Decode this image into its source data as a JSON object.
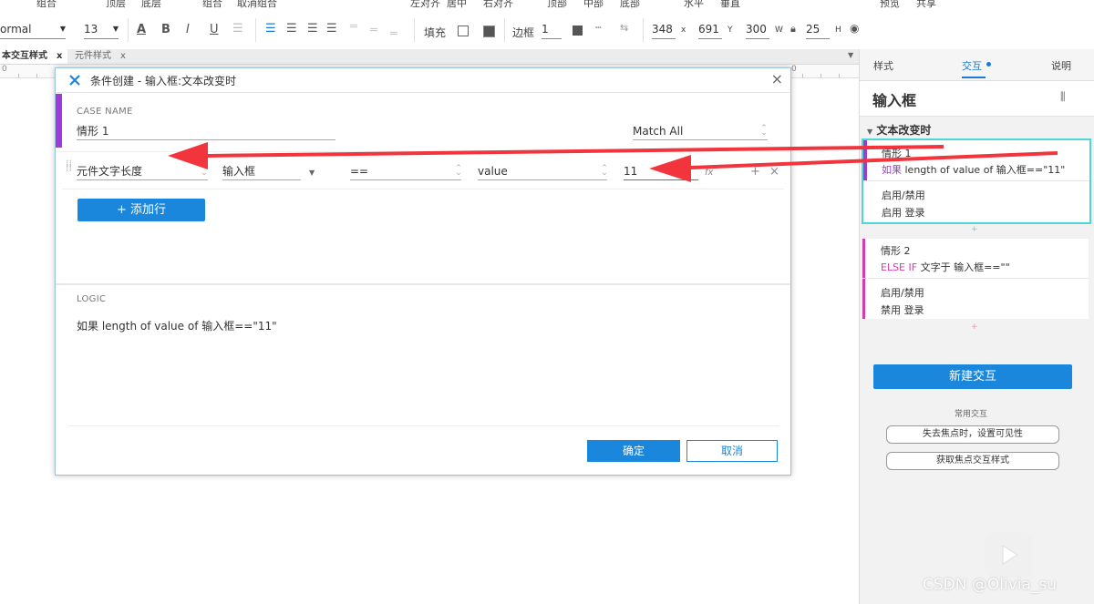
{
  "top_cut": [
    "组合",
    "顶层",
    "底层",
    "组合",
    "取消组合",
    "左对齐",
    "居中",
    "右对齐",
    "顶部",
    "中部",
    "底部",
    "水平",
    "垂直",
    "预览",
    "共享"
  ],
  "toolbar": {
    "style_value": "ormal",
    "font_size": "13",
    "fill_label": "填充",
    "border_label": "边框",
    "border_value": "1",
    "x_value": "348",
    "x_label": "x",
    "y_value": "691",
    "y_label": "Y",
    "w_value": "300",
    "w_label": "W",
    "h_value": "25",
    "h_label": "H"
  },
  "doc_tabs": [
    {
      "label": "本交互样式",
      "close": "x"
    },
    {
      "label": "元件样式",
      "close": "x"
    }
  ],
  "ruler": {
    "left_mark": "0",
    "right_mark": "0"
  },
  "right_panel": {
    "tabs": [
      "样式",
      "交互",
      "说明"
    ],
    "widget_name": "输入框",
    "event_name": "文本改变时",
    "case1": {
      "name": "情形 1",
      "cond_keyword": "如果",
      "cond_text": "length of value of 输入框==\"11\"",
      "action_title": "启用/禁用",
      "action_detail": "启用 登录"
    },
    "case2": {
      "name": "情形 2",
      "cond_keyword": "ELSE IF",
      "cond_text": "文字于 输入框==\"\"",
      "action_title": "启用/禁用",
      "action_detail": "禁用 登录"
    },
    "plus": "+",
    "new_interaction": "新建交互",
    "common_title": "常用交互",
    "common_buttons": [
      "失去焦点时，设置可见性",
      "获取焦点交互样式"
    ]
  },
  "dialog": {
    "title": "条件创建  -  输入框:文本改变时",
    "close": "×",
    "case_name_label": "CASE NAME",
    "case_name_value": "情形 1",
    "match_value": "Match All",
    "condition": {
      "type": "元件文字长度",
      "target": "输入框",
      "operator": "==",
      "value_type": "value",
      "value": "11",
      "fx": "fx",
      "add": "+",
      "remove": "×"
    },
    "add_row": "+ 添加行",
    "logic_label": "LOGIC",
    "logic_text": "如果 length of value of 输入框==\"11\"",
    "ok": "确定",
    "cancel": "取消"
  },
  "colors": {
    "accent_blue": "#1a86dc",
    "purple": "#9c3bd8",
    "pink": "#d63ca7",
    "arrow_red": "#f2343c",
    "selection_cyan": "#4fd6d6"
  },
  "watermark": "CSDN @Olivia_su"
}
